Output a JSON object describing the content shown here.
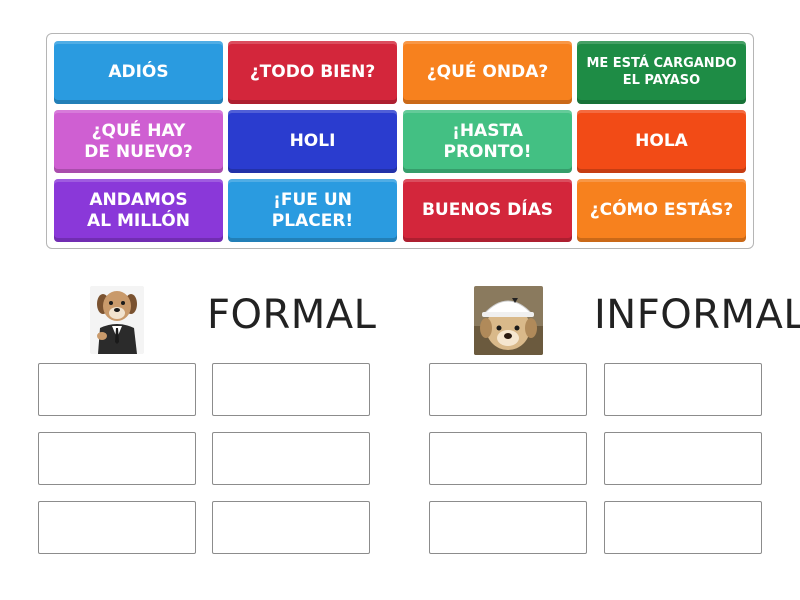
{
  "tiles": [
    {
      "label": "ADIÓS",
      "color": "#2a9be0"
    },
    {
      "label": "¿TODO BIEN?",
      "color": "#d3263b"
    },
    {
      "label": "¿QUÉ ONDA?",
      "color": "#f7811e"
    },
    {
      "label": "ME ESTÁ CARGANDO\nEL PAYASO",
      "color": "#1e8c45"
    },
    {
      "label": "¿QUÉ HAY\nDE NUEVO?",
      "color": "#cf5fd2"
    },
    {
      "label": "HOLI",
      "color": "#2a3ccf"
    },
    {
      "label": "¡HASTA\nPRONTO!",
      "color": "#43c083"
    },
    {
      "label": "HOLA",
      "color": "#f24b16"
    },
    {
      "label": "ANDAMOS\nAL MILLÓN",
      "color": "#8a38d9"
    },
    {
      "label": "¡FUE UN\nPLACER!",
      "color": "#2a9be0"
    },
    {
      "label": "BUENOS DÍAS",
      "color": "#d3263b"
    },
    {
      "label": "¿CÓMO ESTÁS?",
      "color": "#f7811e"
    }
  ],
  "categories": [
    {
      "label": "FORMAL",
      "icon": "dog-in-suit-icon"
    },
    {
      "label": "INFORMAL",
      "icon": "dog-with-cap-icon"
    }
  ]
}
